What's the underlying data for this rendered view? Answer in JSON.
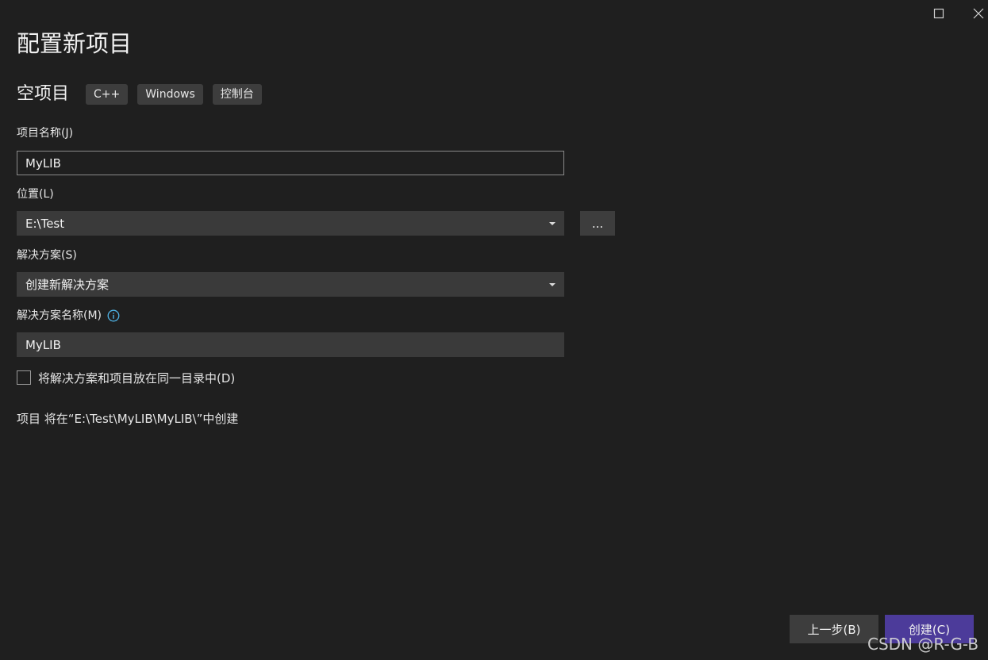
{
  "window": {
    "maximize_icon": "maximize-icon",
    "close_icon": "close-icon"
  },
  "page_title": "配置新项目",
  "template": {
    "name": "空项目",
    "tags": [
      "C++",
      "Windows",
      "控制台"
    ]
  },
  "project_name": {
    "label": "项目名称(J)",
    "value": "MyLIB"
  },
  "location": {
    "label": "位置(L)",
    "value": "E:\\Test",
    "browse_label": "..."
  },
  "solution": {
    "label": "解决方案(S)",
    "value": "创建新解决方案"
  },
  "solution_name": {
    "label": "解决方案名称(M)",
    "value": "MyLIB",
    "info_icon": "info-icon"
  },
  "same_directory": {
    "label": "将解决方案和项目放在同一目录中(D)",
    "checked": false
  },
  "path_note": "项目 将在“E:\\Test\\MyLIB\\MyLIB\\”中创建",
  "footer": {
    "back_label": "上一步(B)",
    "create_label": "创建(C)"
  },
  "watermark": "CSDN @R-G-B",
  "colors": {
    "background": "#1f1f1f",
    "field": "#3a3a3a",
    "button": "#3d3d3d",
    "primary": "#4c3b9a",
    "info": "#4fb3e6"
  }
}
